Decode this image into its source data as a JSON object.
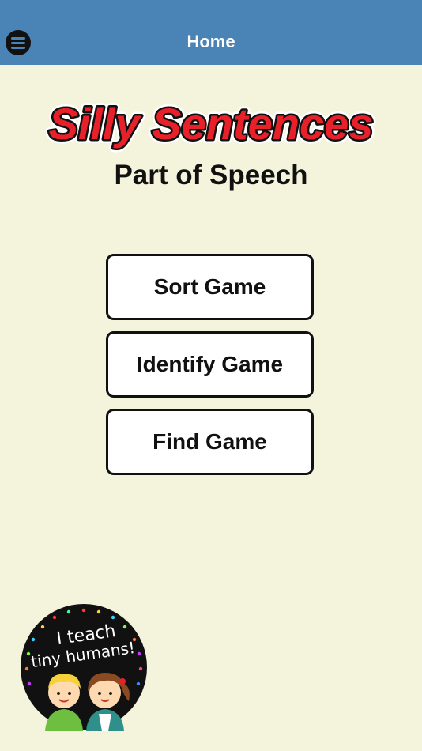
{
  "navbar": {
    "title": "Home",
    "menu_icon": "hamburger-menu-icon",
    "background_color": "#4a84b6"
  },
  "logo": {
    "text": "Silly Sentences",
    "fill_color": "#e8202a"
  },
  "subtitle": "Part of Speech",
  "buttons": [
    {
      "label": "Sort Game"
    },
    {
      "label": "Identify Game"
    },
    {
      "label": "Find Game"
    }
  ],
  "badge": {
    "line1": "I teach",
    "line2": "tiny humans!"
  },
  "colors": {
    "background": "#f4f4dc",
    "button_border": "#111111"
  }
}
